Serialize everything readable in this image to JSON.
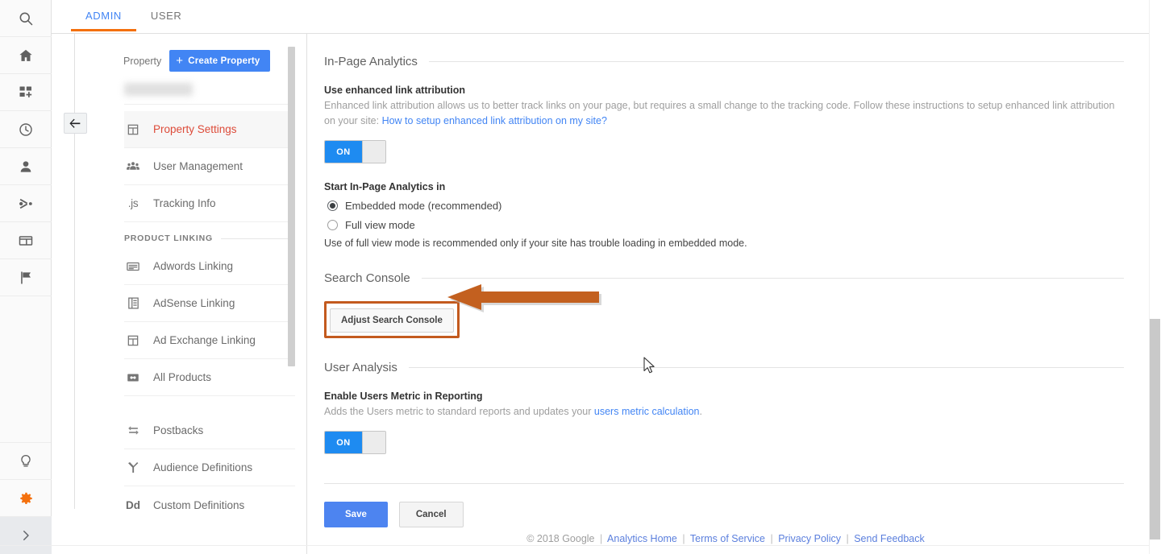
{
  "rail": {
    "items": [
      {
        "name": "search",
        "icon": "search-icon"
      },
      {
        "name": "home",
        "icon": "home-icon"
      },
      {
        "name": "customization",
        "icon": "dashboard-add-icon"
      },
      {
        "name": "realtime",
        "icon": "clock-icon"
      },
      {
        "name": "audience",
        "icon": "person-icon"
      },
      {
        "name": "acquisition",
        "icon": "share-nodes-icon"
      },
      {
        "name": "behavior",
        "icon": "window-icon"
      },
      {
        "name": "conversions",
        "icon": "flag-icon"
      }
    ],
    "bottom": [
      {
        "name": "discover",
        "icon": "lightbulb-icon"
      },
      {
        "name": "admin",
        "icon": "gear-icon"
      }
    ],
    "expand": {
      "name": "expand-nav",
      "icon": "chevron-right-icon"
    }
  },
  "tabs": [
    {
      "label": "ADMIN",
      "active": true
    },
    {
      "label": "USER",
      "active": false
    }
  ],
  "property_panel": {
    "column_label": "Property",
    "create_button": "Create Property",
    "create_plus": "+",
    "product_linking_header": "PRODUCT LINKING",
    "back_button_title": "Back",
    "items": [
      {
        "label": "Property Settings",
        "icon": "property-settings-icon",
        "active": true
      },
      {
        "label": "User Management",
        "icon": "users-icon",
        "active": false
      },
      {
        "label": "Tracking Info",
        "icon": "js-icon",
        "active": false
      }
    ],
    "linking_items": [
      {
        "label": "Adwords Linking",
        "icon": "adwords-icon"
      },
      {
        "label": "AdSense Linking",
        "icon": "adsense-icon"
      },
      {
        "label": "Ad Exchange Linking",
        "icon": "ad-exchange-icon"
      },
      {
        "label": "All Products",
        "icon": "all-products-icon"
      }
    ],
    "other_items": [
      {
        "label": "Postbacks",
        "icon": "postbacks-icon"
      },
      {
        "label": "Audience Definitions",
        "icon": "audience-icon"
      },
      {
        "label": "Custom Definitions",
        "icon": "dd-icon"
      }
    ]
  },
  "main": {
    "sections": {
      "inpage": {
        "title": "In-Page Analytics",
        "enhanced_label": "Use enhanced link attribution",
        "enhanced_desc_1": "Enhanced link attribution allows us to better track links on your page, but requires a small change to the tracking code. Follow these instructions to setup enhanced link attribution on your site: ",
        "enhanced_link": "How to setup enhanced link attribution on my site?",
        "toggle_state": "ON",
        "start_label": "Start In-Page Analytics in",
        "radio_embedded": "Embedded mode (recommended)",
        "radio_fullview": "Full view mode",
        "selected_mode": "Embedded mode (recommended)",
        "hint": "Use of full view mode is recommended only if your site has trouble loading in embedded mode."
      },
      "search_console": {
        "title": "Search Console",
        "adjust_button": "Adjust Search Console"
      },
      "user_analysis": {
        "title": "User Analysis",
        "enable_label": "Enable Users Metric in Reporting",
        "enable_desc_1": "Adds the Users metric to standard reports and updates your ",
        "enable_link": "users metric calculation",
        "enable_desc_2": ".",
        "toggle_state": "ON"
      }
    },
    "save_label": "Save",
    "cancel_label": "Cancel"
  },
  "footer": {
    "copyright": "© 2018 Google",
    "links": [
      "Analytics Home",
      "Terms of Service",
      "Privacy Policy",
      "Send Feedback"
    ],
    "separator": "|"
  },
  "annotation": {
    "arrow_color": "#c3601f",
    "highlight_color": "#c35a1e",
    "target": "Adjust Search Console"
  },
  "colors": {
    "accent_orange": "#f4700d",
    "link_blue": "#4285f4",
    "active_red": "#dd4b39",
    "toggle_on": "#1e8bf1"
  }
}
